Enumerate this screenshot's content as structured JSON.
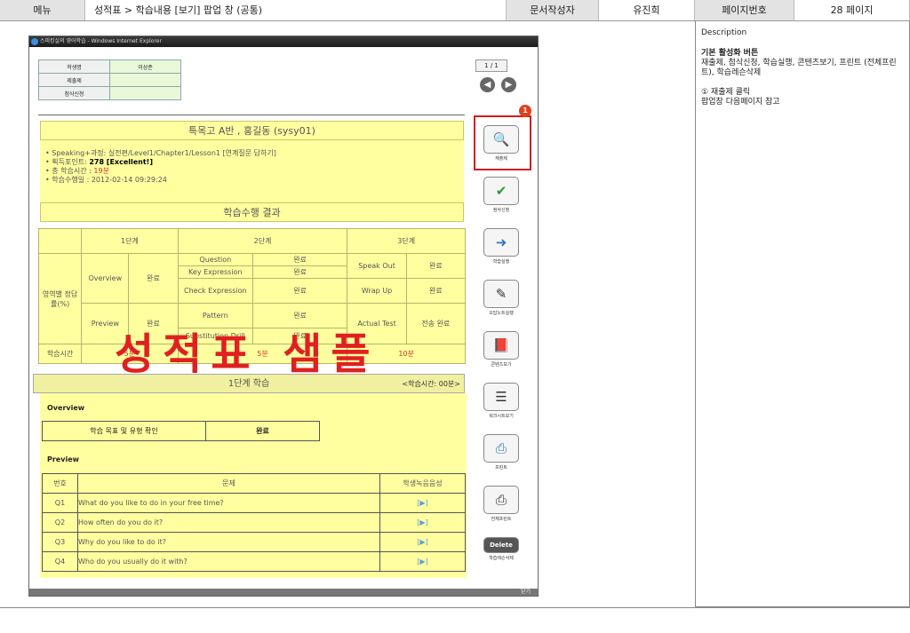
{
  "header": {
    "menu": "메뉴",
    "breadcrumb": "성적표 > 학습내용 [보기] 팝업 창 (공통)",
    "author_label": "문서작성자",
    "author_name": "유진희",
    "page_label": "페이지번호",
    "page_value": "28 페이지"
  },
  "window": {
    "title": "스피킹실의 영어학습 - Windows Internet Explorer",
    "close": "닫기"
  },
  "student": {
    "rows": [
      {
        "label": "학생명",
        "value": "이상준"
      },
      {
        "label": "제출제",
        "value": ""
      },
      {
        "label": "첨삭신청",
        "value": ""
      }
    ]
  },
  "pager": "1 / 1",
  "banner": "특목고 A반 , 홍길동 (sysy01)",
  "info": {
    "course": "• Speaking+과정: 실전편/Level1/Chapter1/Lesson1 [연계질문 답하기]",
    "points_prefix": "• 획득포인트: ",
    "points": "278 [Excellent!]",
    "time_prefix": "• 총 학습시간 : ",
    "time_value": "19분",
    "date": "• 학습수행일 : 2012-02-14 09:29:24"
  },
  "results": {
    "title": "학습수행 결과",
    "stage1": "1단계",
    "stage2": "2단계",
    "stage3": "3단계",
    "row_label": "영역별 정답률(%)",
    "overview": "Overview",
    "preview": "Preview",
    "done": "완료",
    "question": "Question",
    "key_expression": "Key Expression",
    "check_expression": "Check Expression",
    "pattern": "Pattern",
    "substitution": "Substitution Drill",
    "speak_out": "Speak Out",
    "wrap_up": "Wrap Up",
    "actual_test": "Actual Test",
    "sent_done": "전송 완료",
    "time_label": "학습시간",
    "t1": "5분",
    "t2": "5분",
    "t3": "10분"
  },
  "stamp": "성적표 샘플",
  "stage1": {
    "title": "1단계 학습",
    "time": "<학습시간: 00분>",
    "overview_label": "Overview",
    "overview_task": "학습 목표 및 유형 확인",
    "overview_status": "완료",
    "preview_label": "Preview",
    "col_no": "번호",
    "col_q": "문제",
    "col_rec": "학생녹음음성",
    "rows": [
      {
        "no": "Q1",
        "q": "What do you like to do in your free time?",
        "play": "[▶]"
      },
      {
        "no": "Q2",
        "q": "How often do you do it?",
        "play": "[▶]"
      },
      {
        "no": "Q3",
        "q": "Why do you like to do it?",
        "play": "[▶]"
      },
      {
        "no": "Q4",
        "q": "Who do you usually do it with?",
        "play": "[▶]"
      }
    ]
  },
  "side_buttons": [
    {
      "label": "재출제",
      "icon": "magnifier-icon"
    },
    {
      "label": "첨삭신청",
      "icon": "shield-check-icon"
    },
    {
      "label": "학습실행",
      "icon": "monitor-arrow-icon"
    },
    {
      "label": "오답노트실행",
      "icon": "checklist-icon"
    },
    {
      "label": "콘텐츠보기",
      "icon": "book-icon"
    },
    {
      "label": "워크시트보기",
      "icon": "document-icon"
    },
    {
      "label": "프린트",
      "icon": "printer-icon"
    },
    {
      "label": "전체프린트",
      "icon": "print-all-icon"
    },
    {
      "label": "학습레슨삭제",
      "icon": "delete-icon",
      "text": "Delete"
    }
  ],
  "badge": "1",
  "description": {
    "title": "Description",
    "subtitle": "기본 활성화 버튼",
    "text1": "재출제, 첨삭신청, 학습실행, 콘텐츠보기, 프린트 (전체프린트), 학습레슨삭제",
    "text2": "① 재출제 클릭",
    "text3": "팝업창 다음페이지 참고"
  },
  "colors": {
    "accent_red": "#d61c1c",
    "highlight_yellow": "#ffffa0"
  }
}
